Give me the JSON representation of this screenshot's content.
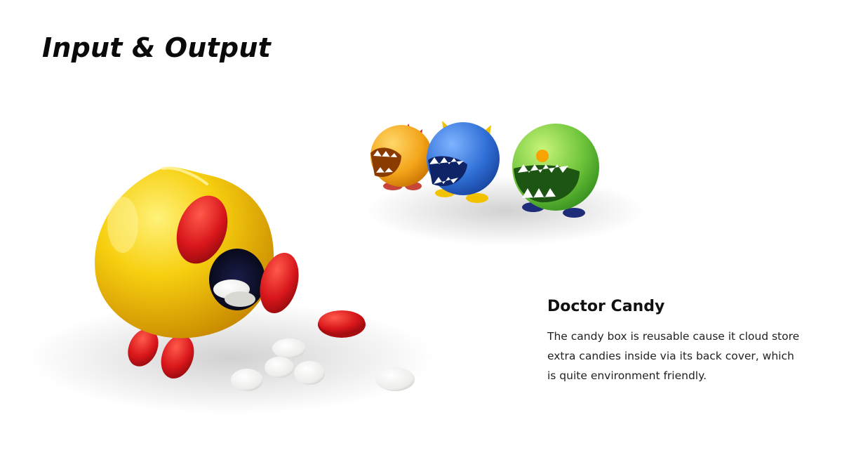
{
  "slide": {
    "title": "Input & Output"
  },
  "product": {
    "name": "Doctor Candy",
    "description": "The candy box is reusable cause it cloud store extra candies inside via its back cover, which is quite environment friendly."
  },
  "colors": {
    "yellow": "#f5c400",
    "red": "#d8161b",
    "orange": "#f3a51a",
    "blue": "#2f6fd6",
    "green": "#6cc33a",
    "navy": "#1f2c7a",
    "candy": "#f1f1ea"
  }
}
